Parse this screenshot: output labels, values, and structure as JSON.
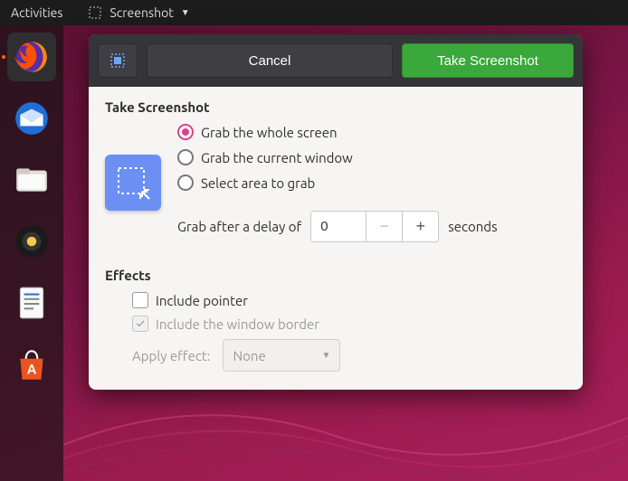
{
  "topbar": {
    "activities": "Activities",
    "app_name": "Screenshot"
  },
  "dock": {
    "items": [
      "firefox",
      "thunderbird",
      "files",
      "rhythmbox",
      "libreoffice-writer",
      "ubuntu-software"
    ]
  },
  "dialog": {
    "header": {
      "cancel": "Cancel",
      "take": "Take Screenshot"
    },
    "section_title": "Take Screenshot",
    "options": {
      "whole": "Grab the whole screen",
      "window": "Grab the current window",
      "area": "Select area to grab",
      "selected": "whole"
    },
    "delay": {
      "prefix": "Grab after a delay of",
      "value": "0",
      "suffix": "seconds",
      "minus": "−",
      "plus": "+"
    },
    "effects": {
      "title": "Effects",
      "include_pointer": "Include pointer",
      "include_border": "Include the window border",
      "apply_label": "Apply effect:",
      "apply_value": "None"
    }
  }
}
